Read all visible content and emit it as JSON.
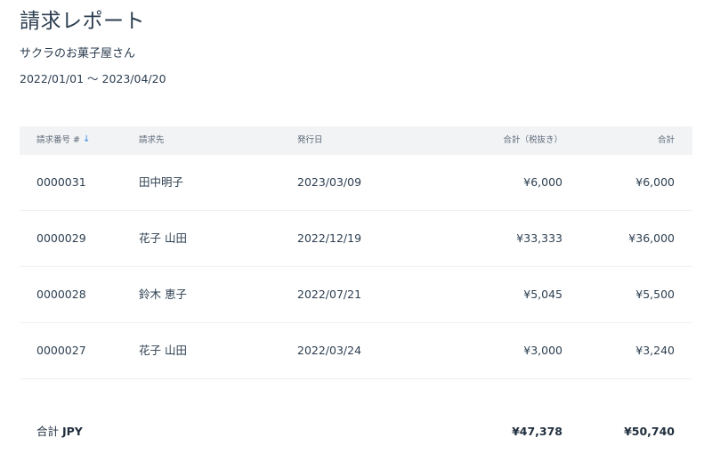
{
  "report": {
    "title": "請求レポート",
    "customer": "サクラのお菓子屋さん",
    "period": "2022/01/01 〜 2023/04/20"
  },
  "table": {
    "headers": {
      "invoice_no": "請求番号 #",
      "bill_to": "請求先",
      "issue_date": "発行日",
      "subtotal": "合計（税抜き）",
      "total": "合計"
    },
    "rows": [
      {
        "invoice_no": "0000031",
        "bill_to": "田中明子",
        "issue_date": "2023/03/09",
        "subtotal": "¥6,000",
        "total": "¥6,000"
      },
      {
        "invoice_no": "0000029",
        "bill_to": "花子 山田",
        "issue_date": "2022/12/19",
        "subtotal": "¥33,333",
        "total": "¥36,000"
      },
      {
        "invoice_no": "0000028",
        "bill_to": "鈴木 恵子",
        "issue_date": "2022/07/21",
        "subtotal": "¥5,045",
        "total": "¥5,500"
      },
      {
        "invoice_no": "0000027",
        "bill_to": "花子 山田",
        "issue_date": "2022/03/24",
        "subtotal": "¥3,000",
        "total": "¥3,240"
      }
    ],
    "footer": {
      "label": "合計",
      "currency": "JPY",
      "subtotal": "¥47,378",
      "total": "¥50,740"
    }
  },
  "icons": {
    "sort": "sort-descending-arrow-icon"
  },
  "colors": {
    "text": "#2c3e50",
    "header_bg": "#f2f3f5",
    "sort_icon": "#3a8ee6"
  }
}
